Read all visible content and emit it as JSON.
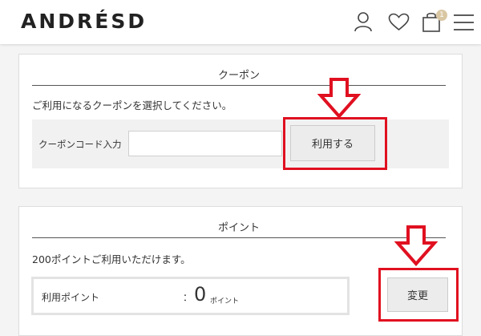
{
  "header": {
    "logo": "ANDRÉSD",
    "cart_count": "1",
    "icons": [
      "user-icon",
      "heart-icon",
      "cart-icon",
      "menu-icon"
    ]
  },
  "coupon": {
    "title": "クーポン",
    "description": "ご利用になるクーポンを選択してください。",
    "code_label": "クーポンコード入力",
    "code_value": "",
    "apply_label": "利用する"
  },
  "points": {
    "title": "ポイント",
    "description": "200ポイントご利用いただけます。",
    "use_label": "利用ポイント",
    "separator": "：",
    "value": "0",
    "unit": "ポイント",
    "change_label": "変更"
  },
  "colors": {
    "highlight": "#e01020",
    "badge": "#d9c7a4"
  }
}
